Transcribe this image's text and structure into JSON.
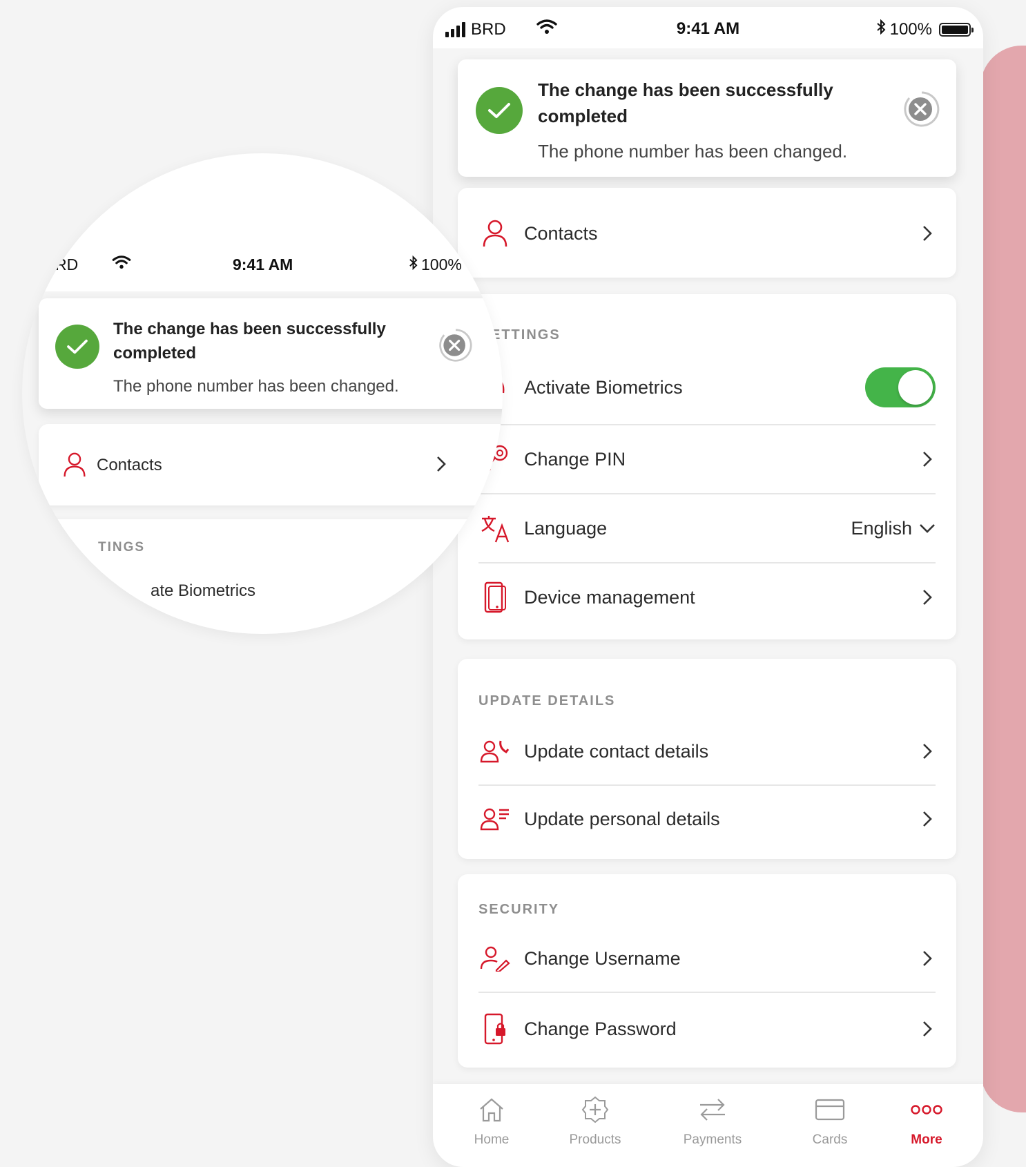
{
  "status": {
    "carrier": "BRD",
    "time": "9:41 AM",
    "battery": "100%"
  },
  "toast": {
    "title": "The change has been successfully completed",
    "message": "The phone number has been changed."
  },
  "contacts": {
    "label": "Contacts"
  },
  "settings": {
    "section_title": "SETTINGS",
    "section_title_visible": "ETTINGS",
    "biometrics_label": "Activate Biometrics",
    "biometrics_enabled": true,
    "change_pin_label": "Change PIN",
    "language_label": "Language",
    "language_value": "English",
    "device_label": "Device management"
  },
  "update_details": {
    "section_title": "UPDATE DETAILS",
    "contact_label": "Update contact details",
    "personal_label": "Update personal details"
  },
  "security": {
    "section_title": "SECURITY",
    "username_label": "Change Username",
    "password_label": "Change Password"
  },
  "tabbar": {
    "home": "Home",
    "products": "Products",
    "payments": "Payments",
    "cards": "Cards",
    "more": "More",
    "active": "More"
  },
  "magnifier": {
    "carrier": "RD",
    "time": "9:41 AM",
    "battery": "100%",
    "title": "The change has been successfully completed",
    "message": "The phone number has been changed.",
    "contacts": "Contacts",
    "settings": "TINGS",
    "biometrics": "ate Biometrics"
  },
  "colors": {
    "accent": "#d6182a",
    "success": "#56a83c",
    "toggle_on": "#44b449",
    "side_strip": "#e3a7ad"
  }
}
